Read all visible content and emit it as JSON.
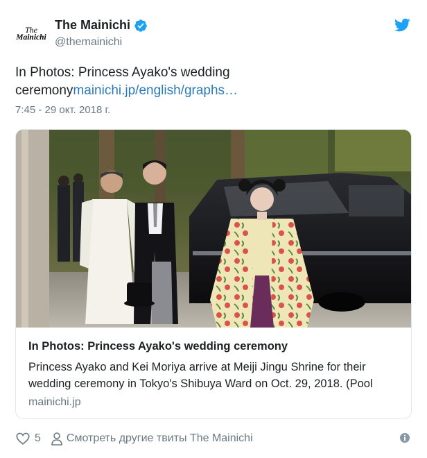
{
  "account": {
    "avatar_line1": "The",
    "avatar_line2": "Mainichi",
    "display_name": "The Mainichi",
    "handle": "@themainichi",
    "verified": true
  },
  "tweet": {
    "text_prefix": "In Photos: Princess Ayako's wedding ceremony",
    "link_text": "mainichi.jp/english/graphs…",
    "timestamp": "7:45 - 29 окт. 2018 г."
  },
  "card": {
    "title": "In Photos: Princess Ayako's wedding ceremony",
    "description": "Princess Ayako and Kei Moriya arrive at Meiji Jingu Shrine for their wedding ceremony in Tokyo's Shibuya Ward on Oct. 29, 2018. (Pool",
    "domain": "mainichi.jp"
  },
  "footer": {
    "like_count": "5",
    "more_tweets_label": "Смотреть другие твиты The Mainichi"
  },
  "colors": {
    "link": "#2b7bb9",
    "twitter_blue": "#1da1f2",
    "secondary_text": "#697882",
    "border": "#e1e8ed"
  },
  "icons": {
    "verified": "verified-badge-icon",
    "logo": "twitter-bird-icon",
    "like": "heart-outline-icon",
    "profile": "person-outline-icon",
    "info": "info-circle-icon"
  }
}
